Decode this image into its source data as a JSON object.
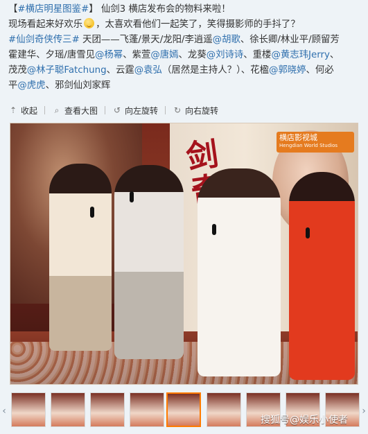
{
  "post": {
    "hashtag1": "#横店明星图鉴#",
    "title": "仙剑3 横店发布会的物料来啦！",
    "line2a": "现场看起来好欢乐",
    "line2b": "，太喜欢看他们一起笑了，笑得摄影师的手抖了？",
    "hashtag2": "#仙剑奇侠传三#",
    "seg1": " 天团——飞蓬/景天/龙阳/李逍遥",
    "m1": "@胡歌",
    "seg2": "、徐长卿/林业平/顾留芳",
    "seg3": "霍建华、夕瑶/唐雪见",
    "m2": "@杨幂",
    "seg4": "、紫萱",
    "m3": "@唐嫣",
    "seg5": "、龙葵",
    "m4": "@刘诗诗",
    "seg6": "、重楼",
    "m5": "@黄志玮Jerry",
    "seg7": "、",
    "seg8": "茂茂",
    "m6": "@林子聪Fatchung",
    "seg9": "、云霆",
    "m7": "@袁弘",
    "seg10": "（居然是主持人？）、花楹",
    "m8": "@郭晓婷",
    "seg11": "、何必",
    "seg12": "平",
    "m9": "@虎虎",
    "seg13": "、邪剑仙刘家辉"
  },
  "toolbar": {
    "collapse": "收起",
    "view_large": "查看大图",
    "rotate_left": "向左旋转",
    "rotate_right": "向右旋转"
  },
  "photo": {
    "logo_main": "横店影视城",
    "logo_sub": "Hengdian World Studios"
  },
  "watermark": "搜狐号@娱乐小使者"
}
